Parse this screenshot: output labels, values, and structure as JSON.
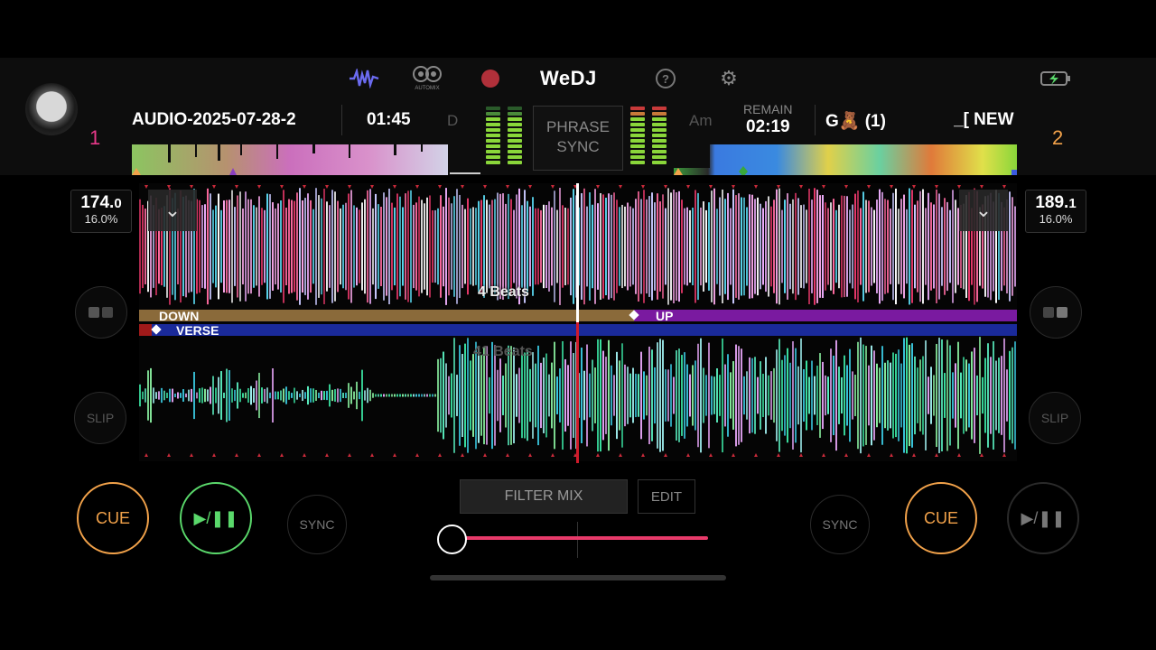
{
  "header": {
    "logo": "WeDJ",
    "automix_label": "AUTOMIX"
  },
  "deck1": {
    "number": "1",
    "track_title": "AUDIO-2025-07-28-2",
    "elapsed": "01:45",
    "key": "D",
    "bpm_main": "174.",
    "bpm_dec": "0",
    "pitch": "16.0%",
    "cue_label": "CUE",
    "play_label": "▶/❚❚",
    "sync_label": "SYNC",
    "slip_label": "SLIP",
    "color": "#e8398a"
  },
  "deck2": {
    "number": "2",
    "track_title": "_[ NEW",
    "artist": "G🧸 (1)",
    "key": "Am",
    "remain_label": "REMAIN",
    "remain": "02:19",
    "bpm_main": "189.",
    "bpm_dec": "1",
    "pitch": "16.0%",
    "cue_label": "CUE",
    "play_label": "▶/❚❚",
    "sync_label": "SYNC",
    "slip_label": "SLIP",
    "color": "#f2a24a"
  },
  "center": {
    "phrase_sync_line1": "PHRASE",
    "phrase_sync_line2": "SYNC",
    "beats_top": "4 Beats",
    "beats_bottom": "41 Beats",
    "phrase_down": "DOWN",
    "phrase_up": "UP",
    "phrase_verse": "VERSE",
    "filter_mix": "FILTER MIX",
    "edit": "EDIT"
  },
  "crossfader": {
    "position": 0.0,
    "accent": "#e83a6a"
  }
}
